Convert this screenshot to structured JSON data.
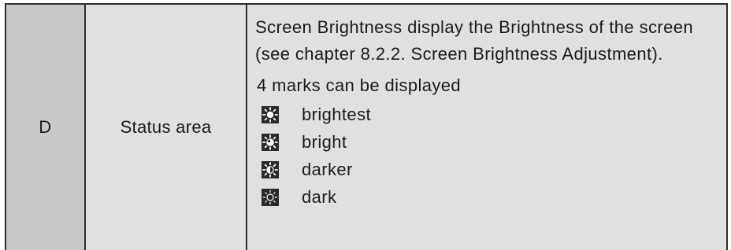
{
  "row": {
    "id": "D",
    "name": "Status area",
    "description": "Screen Brightness display the Brightness of the screen (see chapter 8.2.2. Screen Brightness Adjustment).",
    "marks_title": "4 marks can be displayed",
    "marks": [
      {
        "icon": "sun-full-icon",
        "label": "brightest"
      },
      {
        "icon": "sun-three-quarter-icon",
        "label": "bright"
      },
      {
        "icon": "sun-half-icon",
        "label": "darker"
      },
      {
        "icon": "sun-empty-icon",
        "label": "dark"
      }
    ]
  },
  "colors": {
    "id_cell_bg": "#c9c9c9",
    "cell_bg": "#e0e0e0",
    "border": "#2b2b2b",
    "icon_bg": "#2a2a2a"
  }
}
